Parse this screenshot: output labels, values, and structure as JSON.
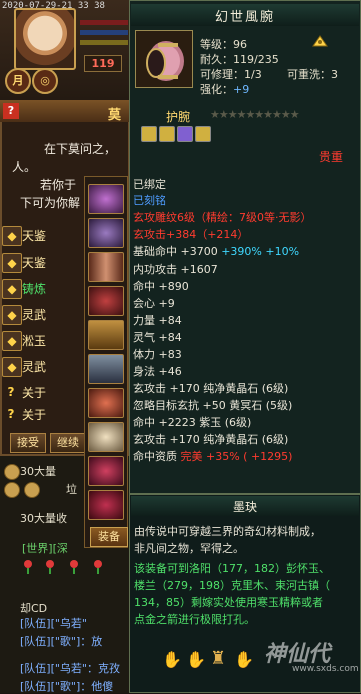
{
  "hud": {
    "timestamp": "2020-07-29-21 33 38",
    "level": "119",
    "btn_yue": "月",
    "btn_target": "◎"
  },
  "dialog": {
    "title": "莫",
    "help": "?",
    "lines": [
      "在下莫问之，",
      "人。",
      "若你于",
      "下可为你解"
    ],
    "menu": [
      {
        "icon": "card-icon",
        "label": "天鉴"
      },
      {
        "icon": "card-icon",
        "label": "天鉴"
      },
      {
        "icon": "card-icon",
        "label": "铸炼",
        "green": true
      },
      {
        "icon": "card-icon",
        "label": "灵武"
      },
      {
        "icon": "card-icon",
        "label": "淞玉"
      },
      {
        "icon": "card-icon",
        "label": "灵武"
      },
      {
        "icon": "question-icon",
        "label": "关于"
      },
      {
        "icon": "question-icon",
        "label": "关于"
      }
    ],
    "btn_accept": "接受",
    "btn_continue": "继续"
  },
  "equip_button": "装备",
  "chat": {
    "money_labels": [
      "30大量",
      "垃"
    ],
    "lines": [
      "30大量收",
      "[世界][深",
      "却CD",
      "[队伍][\"乌若\"",
      "[队伍][\"歌\"]：放",
      "[队伍][\"乌若\"：克孜",
      "[队伍][\"歌\"]：他傻"
    ]
  },
  "tooltip": {
    "title": "幻世風腕",
    "stats": {
      "level": "等级：96",
      "durability": "耐久：119/235",
      "repair": "可修理：1/3",
      "wash": "可重洗：3",
      "enhance_label": "强化：",
      "enhance_value": "+9"
    },
    "slot_label": "护腕",
    "stars": "★★★★★★★★★★",
    "rarity": "贵重",
    "props": [
      {
        "text": "已绑定",
        "color": "white"
      },
      {
        "text": "已刻铭",
        "color": "blue"
      },
      {
        "text": "玄攻雕纹6级（精绘：7级0等·无影）",
        "color": "red"
      },
      {
        "text": "玄攻击+384（+214）",
        "color": "red"
      },
      {
        "text": "基础命中 +3700 +390% +10%",
        "color": "mixed"
      },
      {
        "text": "内功攻击 +1607",
        "color": "white"
      },
      {
        "text": "命中 +890",
        "color": "white"
      },
      {
        "text": "会心 +9",
        "color": "white"
      },
      {
        "text": "力量 +84",
        "color": "white"
      },
      {
        "text": "灵气 +84",
        "color": "white"
      },
      {
        "text": "体力 +83",
        "color": "white"
      },
      {
        "text": "身法 +46",
        "color": "white"
      },
      {
        "text": "玄攻击 +170 纯净黄晶石 (6级)",
        "color": "white"
      },
      {
        "text": "忽略目标玄抗 +50 黄冥石 (5级)",
        "color": "white"
      },
      {
        "text": "命中 +2223 紫玉 (6级)",
        "color": "white"
      },
      {
        "text": "玄攻击 +170 纯净黄晶石 (6级)",
        "color": "white"
      },
      {
        "text": "命中资质  完美 +35% ( +1295)",
        "color": "mixed2"
      }
    ],
    "prop_parts": {
      "base_hit_label": "基础命中 +3700 ",
      "base_hit_pct": "+390% +10%",
      "aptitude_label": "命中资质  ",
      "aptitude_value": "完美 +35% ( +1295)"
    }
  },
  "lore": {
    "title": "墨玦",
    "lines_white": [
      "由传说中可穿越三界的奇幻材料制成，",
      "非凡间之物，罕得之。"
    ],
    "lines_green": [
      "该装备可到洛阳（177，182）彭怀玉、",
      "楼兰（279，198）克里木、束河古镇（",
      "134，85）剩嫁实处使用寒玉精粹或者",
      "点金之箭进行极限打孔。"
    ]
  },
  "watermark": {
    "text": "神仙代",
    "url": "www.sxds.com"
  }
}
